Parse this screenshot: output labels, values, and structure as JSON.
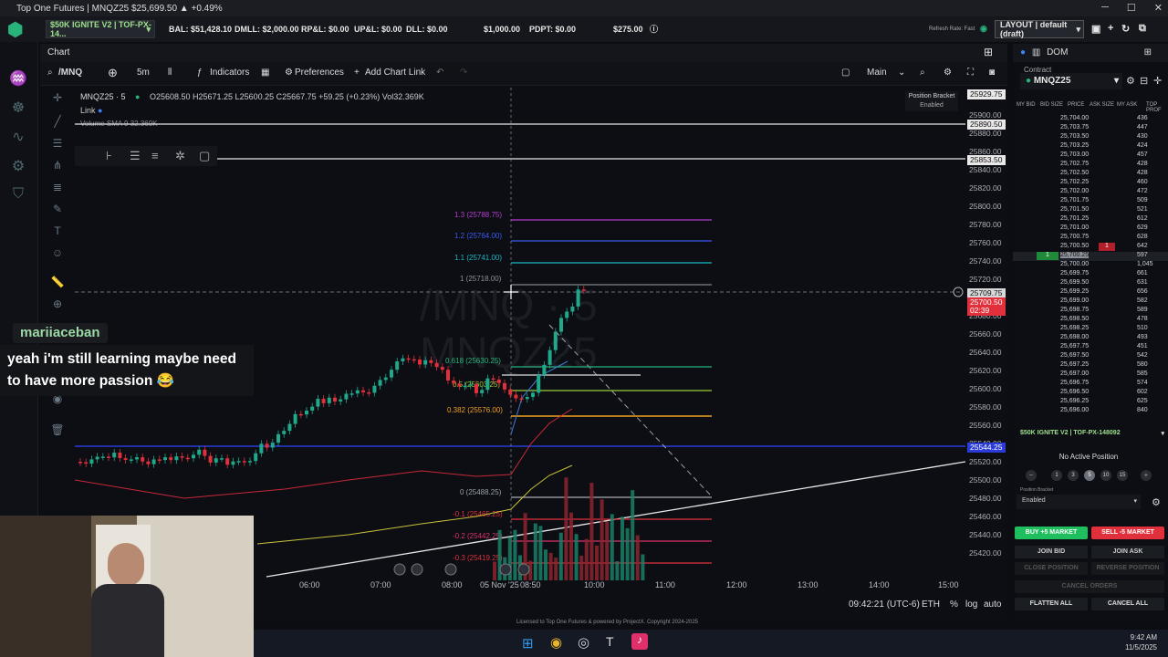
{
  "window": {
    "title": "Top One Futures | MNQZ25 $25,699.50 ▲ +0.49%",
    "controls": [
      "─",
      "☐",
      "✕"
    ]
  },
  "account_bar": {
    "account": "$50K IGNITE V2 | TOF-PX-14...",
    "bal": "BAL: $51,428.10",
    "dmll": "DMLL: $2,000.00",
    "rpl": "RP&L: $0.00",
    "upl": "UP&L: $0.00",
    "dll": "DLL: $0.00",
    "dll_limit": "$1,000.00",
    "pdpt": "PDPT: $0.00",
    "pdpt_limit": "$275.00",
    "refresh": "Refresh Rate: Fast",
    "layout": "LAYOUT | default (draft)"
  },
  "chart_panel": {
    "title": "Chart",
    "symbol_search": "/MNQ",
    "interval": "5m",
    "indicators": "Indicators",
    "preferences": "Preferences",
    "add_chart_link": "Add Chart Link",
    "main": "Main",
    "symbol_label": "MNQZ25 · 5",
    "ohlc": "O25608.50 H25671.25 L25600.25 C25667.75 +59.25 (+0.23%) Vol32.369K",
    "link": "Link",
    "volume": "Volume SMA 9 32.369K",
    "position_bracket": "Position Bracket",
    "enabled": "Enabled",
    "watermark_1": "/MNQ · 5",
    "watermark_2": "MNQZ25"
  },
  "price_axis": {
    "labels": [
      "25900.00",
      "25880.00",
      "25860.00",
      "25840.00",
      "25820.00",
      "25800.00",
      "25780.00",
      "25760.00",
      "25740.00",
      "25720.00",
      "25680.00",
      "25660.00",
      "25640.00",
      "25620.00",
      "25600.00",
      "25580.00",
      "25560.00",
      "25540.00",
      "25520.00",
      "25500.00",
      "25480.00",
      "25460.00",
      "25440.00",
      "25420.00"
    ],
    "boxes": [
      {
        "text": "25929.75",
        "color": "#e9e9e9",
        "fg": "#111"
      },
      {
        "text": "25890.50",
        "color": "#e9e9e9",
        "fg": "#111"
      },
      {
        "text": "25853.50",
        "color": "#e9e9e9",
        "fg": "#111"
      },
      {
        "text": "25709.75",
        "color": "#d8d8d8",
        "fg": "#111"
      },
      {
        "text": "25700.50",
        "color": "#e0303b",
        "fg": "#fff"
      },
      {
        "text": "02:39",
        "color": "#e0303b",
        "fg": "#fff"
      },
      {
        "text": "25544.25",
        "color": "#2a3bd8",
        "fg": "#fff"
      }
    ]
  },
  "fib_labels": [
    "1.3 (25788.75)",
    "1.2 (25764.00)",
    "1.1 (25741.00)",
    "1 (25718.00)",
    "0.618 (25630.25)",
    "0.5 (25603.25)",
    "0.382 (25576.00)",
    "0 (25488.25)",
    "-0.1 (25465.25)",
    "-0.2 (25442.25)",
    "-0.3 (25419.25)"
  ],
  "time_axis": [
    "06:00",
    "07:00",
    "08:00",
    "05 Nov '25",
    "08:50",
    "10:00",
    "11:00",
    "12:00",
    "13:00",
    "14:00",
    "15:00"
  ],
  "status_bar": {
    "time": "09:42:21 (UTC-6)",
    "session": "ETH",
    "pct": "%",
    "log": "log",
    "auto": "auto"
  },
  "dom": {
    "title": "DOM",
    "contract_label": "Contract",
    "contract": "MNQZ25",
    "columns": [
      "MY BID",
      "BID SIZE",
      "PRICE",
      "ASK SIZE",
      "MY ASK",
      "TOP PROF"
    ],
    "rows": [
      {
        "price": "25,704.00",
        "ask": "436"
      },
      {
        "price": "25,703.75",
        "ask": "447"
      },
      {
        "price": "25,703.50",
        "ask": "430"
      },
      {
        "price": "25,703.25",
        "ask": "424"
      },
      {
        "price": "25,703.00",
        "ask": "457"
      },
      {
        "price": "25,702.75",
        "ask": "428"
      },
      {
        "price": "25,702.50",
        "ask": "428"
      },
      {
        "price": "25,702.25",
        "ask": "460"
      },
      {
        "price": "25,702.00",
        "ask": "472"
      },
      {
        "price": "25,701.75",
        "ask": "509"
      },
      {
        "price": "25,701.50",
        "ask": "521"
      },
      {
        "price": "25,701.25",
        "ask": "612"
      },
      {
        "price": "25,701.00",
        "ask": "629"
      },
      {
        "price": "25,700.75",
        "ask": "628"
      },
      {
        "price": "25,700.50",
        "ask": "642"
      },
      {
        "price": "25,700.25",
        "ask": "597"
      },
      {
        "price": "25,700.00",
        "ask": "1,045"
      },
      {
        "price": "25,699.75",
        "ask": "661"
      },
      {
        "price": "25,699.50",
        "ask": "631"
      },
      {
        "price": "25,699.25",
        "ask": "656"
      },
      {
        "price": "25,699.00",
        "ask": "582"
      },
      {
        "price": "25,698.75",
        "ask": "589"
      },
      {
        "price": "25,698.50",
        "ask": "478"
      },
      {
        "price": "25,698.25",
        "ask": "510"
      },
      {
        "price": "25,698.00",
        "ask": "493"
      },
      {
        "price": "25,697.75",
        "ask": "451"
      },
      {
        "price": "25,697.50",
        "ask": "542"
      },
      {
        "price": "25,697.25",
        "ask": "580"
      },
      {
        "price": "25,697.00",
        "ask": "585"
      },
      {
        "price": "25,696.75",
        "ask": "574"
      },
      {
        "price": "25,696.50",
        "ask": "602"
      },
      {
        "price": "25,696.25",
        "ask": "625"
      },
      {
        "price": "25,696.00",
        "ask": "840"
      }
    ],
    "my_bid_marker": "1",
    "my_ask_marker": "1",
    "account": "$50K IGNITE V2 | TOF-PX-148092",
    "no_position": "No Active Position",
    "qty": [
      "1",
      "3",
      "5",
      "10",
      "15"
    ],
    "bracket_label": "Position Bracket",
    "bracket_value": "Enabled",
    "buy": "BUY +5 MARKET",
    "sell": "SELL -5 MARKET",
    "join_bid": "JOIN BID",
    "join_ask": "JOIN ASK",
    "close_position": "CLOSE POSITION",
    "reverse_position": "REVERSE POSITION",
    "cancel_orders": "CANCEL ORDERS",
    "flatten_all": "FLATTEN ALL",
    "cancel_all": "CANCEL ALL"
  },
  "chat": {
    "name": "mariiaceban",
    "message": "yeah i'm still learning maybe need to have more passion 😂"
  },
  "footer": {
    "license": "Licensed to Top One Futures & powered by ProjectX. Copyright 2024-2025",
    "clock_time": "9:42 AM",
    "clock_date": "11/5/2025"
  },
  "colors": {
    "bull": "#1fa88a",
    "bear": "#e0303b",
    "blue_line": "#2a3bd8",
    "accent_green": "#1fbf5f"
  }
}
